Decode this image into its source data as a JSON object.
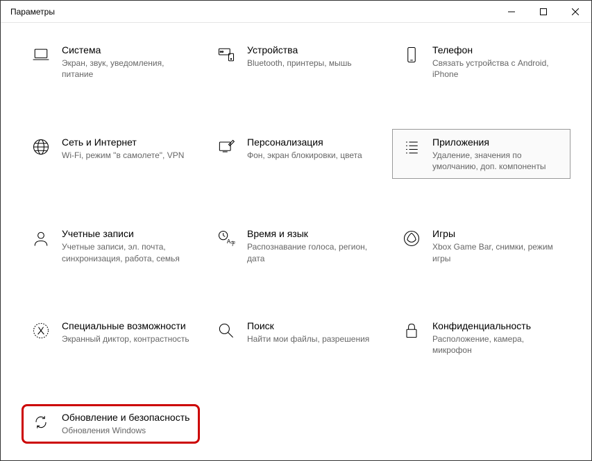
{
  "window": {
    "title": "Параметры"
  },
  "tiles": {
    "system": {
      "title": "Система",
      "desc": "Экран, звук, уведомления, питание"
    },
    "devices": {
      "title": "Устройства",
      "desc": "Bluetooth, принтеры, мышь"
    },
    "phone": {
      "title": "Телефон",
      "desc": "Связать устройства с Android, iPhone"
    },
    "network": {
      "title": "Сеть и Интернет",
      "desc": "Wi-Fi, режим \"в самолете\", VPN"
    },
    "personalization": {
      "title": "Персонализация",
      "desc": "Фон, экран блокировки, цвета"
    },
    "apps": {
      "title": "Приложения",
      "desc": "Удаление, значения по умолчанию, доп. компоненты"
    },
    "accounts": {
      "title": "Учетные записи",
      "desc": "Учетные записи, эл. почта, синхронизация, работа, семья"
    },
    "time": {
      "title": "Время и язык",
      "desc": "Распознавание голоса, регион, дата"
    },
    "gaming": {
      "title": "Игры",
      "desc": "Xbox Game Bar, снимки, режим игры"
    },
    "accessibility": {
      "title": "Специальные возможности",
      "desc": "Экранный диктор, контрастность"
    },
    "search": {
      "title": "Поиск",
      "desc": "Найти мои файлы, разрешения"
    },
    "privacy": {
      "title": "Конфиденциальность",
      "desc": "Расположение, камера, микрофон"
    },
    "update": {
      "title": "Обновление и безопасность",
      "desc": "Обновления Windows"
    }
  }
}
